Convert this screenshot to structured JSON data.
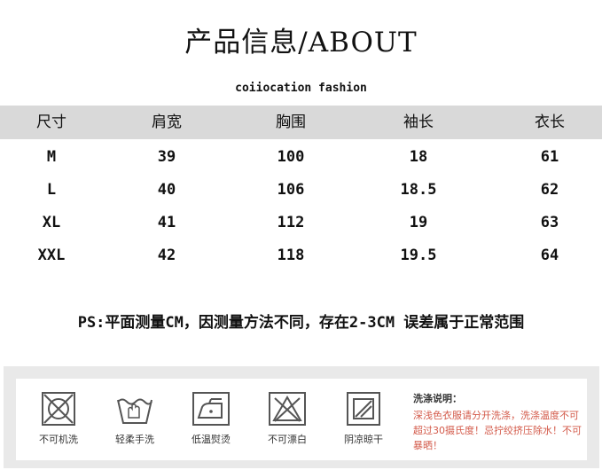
{
  "header": {
    "title": "产品信息/ABOUT",
    "subtitle": "coiiocation fashion"
  },
  "size_table": {
    "columns": [
      "尺寸",
      "肩宽",
      "胸围",
      "袖长",
      "衣长"
    ],
    "rows": [
      [
        "M",
        "39",
        "100",
        "18",
        "61"
      ],
      [
        "L",
        "40",
        "106",
        "18.5",
        "62"
      ],
      [
        "XL",
        "41",
        "112",
        "19",
        "63"
      ],
      [
        "XXL",
        "42",
        "118",
        "19.5",
        "64"
      ]
    ]
  },
  "note": "PS:平面测量CM，因测量方法不同，存在2-3CM 误差属于正常范围",
  "care": {
    "icons": [
      {
        "icon": "no-machine-wash-icon",
        "label": "不可机洗"
      },
      {
        "icon": "gentle-hand-wash-icon",
        "label": "轻柔手洗"
      },
      {
        "icon": "low-temp-iron-icon",
        "label": "低温熨烫"
      },
      {
        "icon": "no-bleach-icon",
        "label": "不可漂白"
      },
      {
        "icon": "shade-dry-icon",
        "label": "阴凉晾干"
      }
    ],
    "wash_title": "洗涤说明：",
    "wash_text": "深浅色衣服请分开洗涤，洗涤温度不可超过30摄氏度！忌拧绞挤压除水！不可暴晒！",
    "colors": {
      "warning_text": "#d35a4a",
      "panel_bg": "#e9e9e9",
      "header_bg": "#d9d9d9"
    }
  }
}
